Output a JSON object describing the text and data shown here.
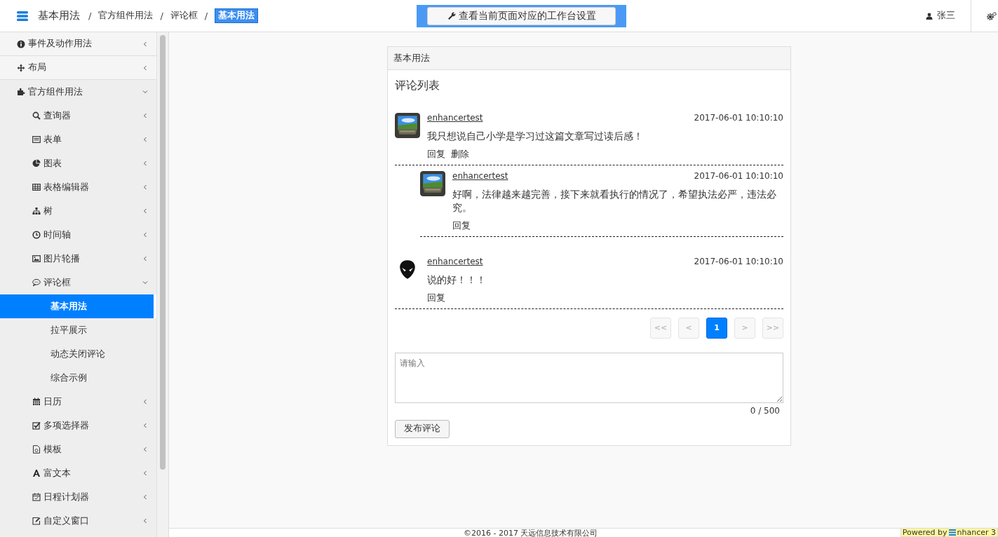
{
  "header": {
    "title": "基本用法",
    "breadcrumb": [
      {
        "separator": "/",
        "label": "官方组件用法",
        "selected": false
      },
      {
        "separator": "/",
        "label": "评论框",
        "selected": false
      },
      {
        "separator": "/",
        "label": "基本用法",
        "selected": true
      }
    ],
    "workbench_button": "查看当前页面对应的工作台设置",
    "user": "张三"
  },
  "sidebar": {
    "items": [
      {
        "label": "事件及动作用法",
        "expanded": false
      },
      {
        "label": "布局",
        "expanded": false
      },
      {
        "label": "官方组件用法",
        "expanded": true,
        "children": [
          {
            "label": "查询器",
            "expanded": false
          },
          {
            "label": "表单",
            "expanded": false
          },
          {
            "label": "图表",
            "expanded": false
          },
          {
            "label": "表格编辑器",
            "expanded": false
          },
          {
            "label": "树",
            "expanded": false
          },
          {
            "label": "时间轴",
            "expanded": false
          },
          {
            "label": "图片轮播",
            "expanded": false
          },
          {
            "label": "评论框",
            "expanded": true,
            "children": [
              {
                "label": "基本用法",
                "selected": true
              },
              {
                "label": "拉平展示",
                "selected": false
              },
              {
                "label": "动态关闭评论",
                "selected": false
              },
              {
                "label": "综合示例",
                "selected": false
              }
            ]
          },
          {
            "label": "日历",
            "expanded": false
          },
          {
            "label": "多项选择器",
            "expanded": false
          },
          {
            "label": "模板",
            "expanded": false
          },
          {
            "label": "富文本",
            "expanded": false
          },
          {
            "label": "日程计划器",
            "expanded": false
          },
          {
            "label": "自定义窗口",
            "expanded": false
          }
        ]
      }
    ]
  },
  "panel": {
    "title": "基本用法",
    "heading": "评论列表",
    "comments": [
      {
        "author": "enhancertest",
        "time": "2017-06-01 10:10:10",
        "text": "我只想说自己小学是学习过这篇文章写过读后感！",
        "avatar": {
          "kind": "picture"
        },
        "actions": [
          "回复",
          "删除"
        ],
        "children": [
          {
            "author": "enhancertest",
            "time": "2017-06-01 10:10:10",
            "text": "好啊，法律越来越完善，接下来就看执行的情况了，希望执法必严，违法必究。",
            "avatar": {
              "kind": "picture"
            },
            "actions": [
              "回复"
            ]
          }
        ]
      },
      {
        "author": "enhancertest",
        "time": "2017-06-01 10:10:10",
        "text": "说的好！！！",
        "avatar": {
          "kind": "alien"
        },
        "actions": [
          "回复"
        ]
      }
    ],
    "pagination": [
      {
        "label": "<<",
        "selected": false,
        "disabled": true
      },
      {
        "label": "<",
        "selected": false,
        "disabled": true
      },
      {
        "label": "1",
        "selected": true,
        "disabled": false
      },
      {
        "label": ">",
        "selected": false,
        "disabled": true
      },
      {
        "label": ">>",
        "selected": false,
        "disabled": true
      }
    ],
    "input": {
      "placeholder": "请输入"
    },
    "counter": "0 / 500",
    "submit": "发布评论"
  },
  "footer": {
    "copyright": "©2016 - 2017 天远信息技术有限公司",
    "powered_prefix": "Powered by",
    "powered_name": "nhancer 3"
  }
}
